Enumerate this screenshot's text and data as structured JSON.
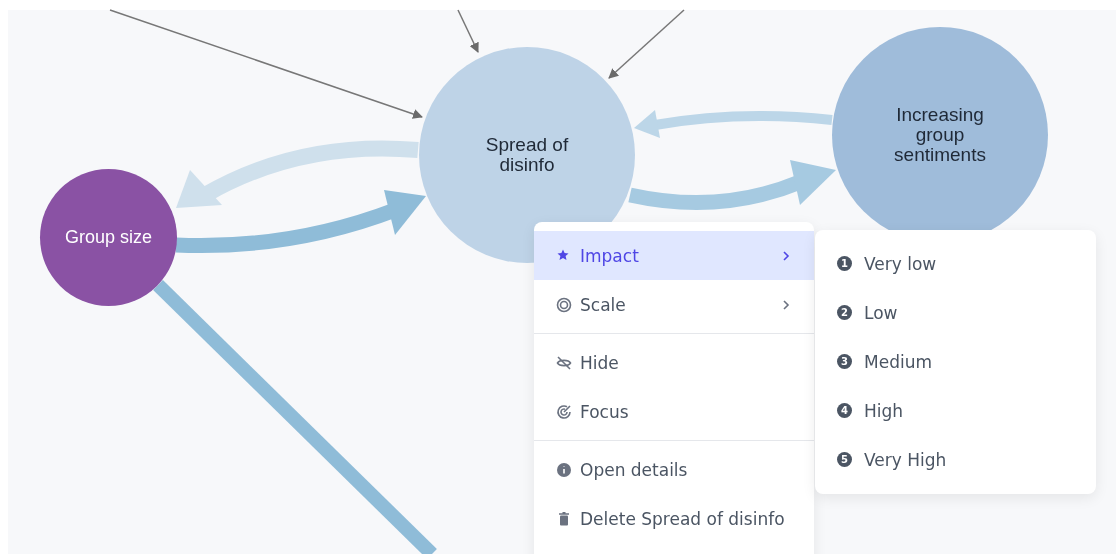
{
  "diagram": {
    "nodes": [
      {
        "label": "Spread of disinfo",
        "color": "#bed3e7",
        "kind": "large"
      },
      {
        "label": "Increasing group sentiments",
        "color": "#9fbcda",
        "kind": "large"
      },
      {
        "label": "Group size",
        "color": "#8a52a4",
        "kind": "small"
      }
    ]
  },
  "context_menu": {
    "sections": [
      [
        {
          "label": "Impact",
          "selected": true,
          "submenu": true
        },
        {
          "label": "Scale",
          "selected": false,
          "submenu": true
        }
      ],
      [
        {
          "label": "Hide",
          "selected": false,
          "submenu": false
        },
        {
          "label": "Focus",
          "selected": false,
          "submenu": false
        }
      ],
      [
        {
          "label": "Open details",
          "selected": false,
          "submenu": false
        },
        {
          "label": "Delete Spread of disinfo",
          "selected": false,
          "submenu": false
        }
      ]
    ]
  },
  "submenu": {
    "items": [
      {
        "number": "1",
        "label": "Very low"
      },
      {
        "number": "2",
        "label": "Low"
      },
      {
        "number": "3",
        "label": "Medium"
      },
      {
        "number": "4",
        "label": "High"
      },
      {
        "number": "5",
        "label": "Very High"
      }
    ]
  }
}
